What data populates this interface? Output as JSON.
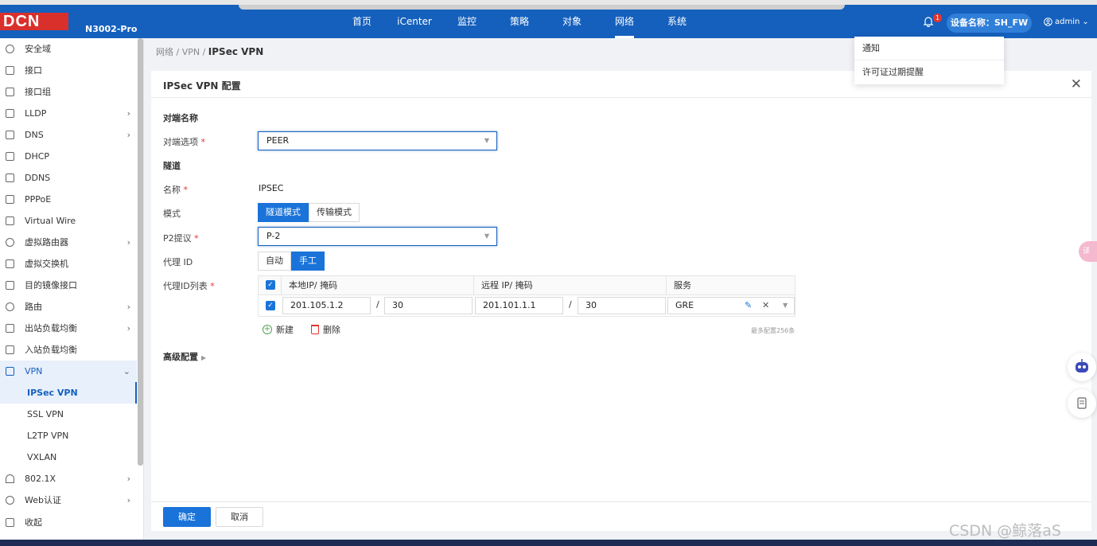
{
  "header": {
    "logo": "DCN",
    "model": "N3002-Pro",
    "nav": [
      "首页",
      "iCenter",
      "监控",
      "策略",
      "对象",
      "网络",
      "系统"
    ],
    "active_nav": "网络",
    "bell_count": "1",
    "device": "设备名称：SH_FW",
    "user": "admin"
  },
  "sidebar": {
    "items": [
      {
        "label": "安全域",
        "arrow": ""
      },
      {
        "label": "接口",
        "arrow": ""
      },
      {
        "label": "接口组",
        "arrow": ""
      },
      {
        "label": "LLDP",
        "arrow": "›"
      },
      {
        "label": "DNS",
        "arrow": "›"
      },
      {
        "label": "DHCP",
        "arrow": ""
      },
      {
        "label": "DDNS",
        "arrow": ""
      },
      {
        "label": "PPPoE",
        "arrow": ""
      },
      {
        "label": "Virtual Wire",
        "arrow": ""
      },
      {
        "label": "虚拟路由器",
        "arrow": "›"
      },
      {
        "label": "虚拟交换机",
        "arrow": ""
      },
      {
        "label": "目的镜像接口",
        "arrow": ""
      },
      {
        "label": "路由",
        "arrow": "›"
      },
      {
        "label": "出站负载均衡",
        "arrow": "›"
      },
      {
        "label": "入站负载均衡",
        "arrow": ""
      },
      {
        "label": "VPN",
        "arrow": "⌄"
      }
    ],
    "vpn_sub": [
      "IPSec VPN",
      "SSL VPN",
      "L2TP VPN",
      "VXLAN"
    ],
    "after": [
      {
        "label": "802.1X",
        "arrow": "›"
      },
      {
        "label": "Web认证",
        "arrow": "›"
      }
    ],
    "collapse": "收起"
  },
  "breadcrumb": {
    "path": "网络 / VPN / ",
    "current": "IPSec VPN"
  },
  "form": {
    "title": "IPSec VPN 配置",
    "peer_section": "对端名称",
    "peer_label": "对端选项",
    "peer_value": "PEER",
    "tunnel_section": "隧道",
    "name_label": "名称",
    "name_value": "IPSEC",
    "mode_label": "模式",
    "mode_options": [
      "隧道模式",
      "传输模式"
    ],
    "p2_label": "P2提议",
    "p2_value": "P-2",
    "proxy_label": "代理 ID",
    "proxy_options": [
      "自动",
      "手工"
    ],
    "proxy_list_label": "代理ID列表",
    "columns": [
      "本地IP/ 掩码",
      "远程 IP/ 掩码",
      "服务"
    ],
    "row": {
      "local_ip": "201.105.1.2",
      "local_mask": "30",
      "remote_ip": "201.101.1.1",
      "remote_mask": "30",
      "service": "GRE"
    },
    "add": "新建",
    "delete": "删除",
    "max_note": "最多配置256条",
    "advanced": "高级配置",
    "ok": "确定",
    "cancel": "取消"
  },
  "notification": {
    "title": "通知",
    "item": "许可证过期提醒"
  },
  "side_tab": "译",
  "watermark": "CSDN @鲸落aS"
}
